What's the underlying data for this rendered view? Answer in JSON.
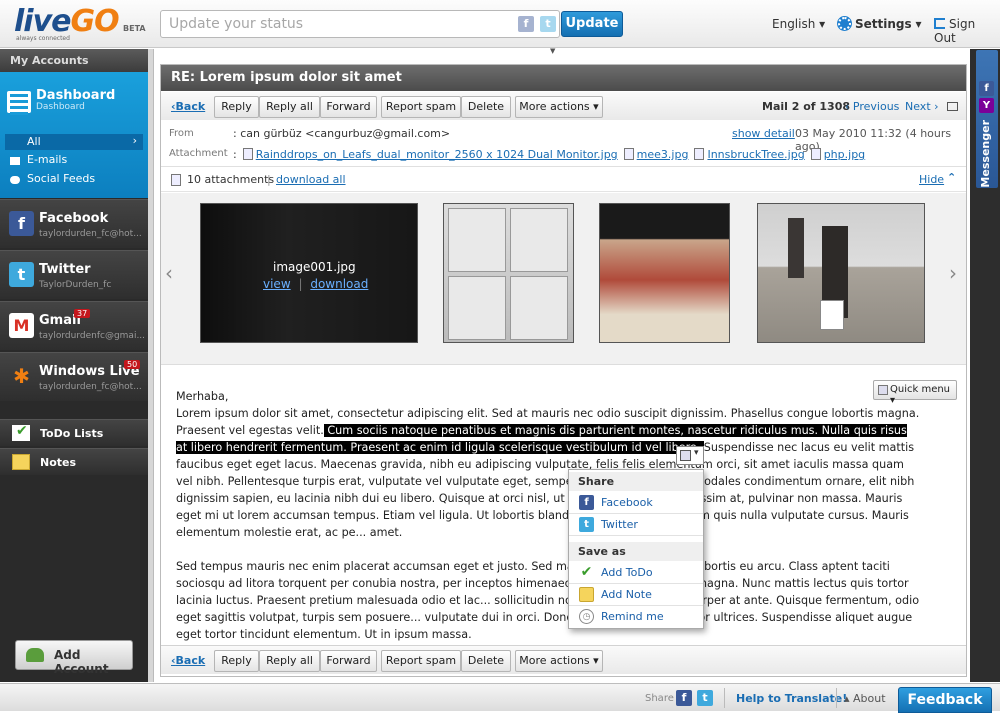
{
  "app": {
    "logo_live": "live",
    "logo_go": "GO",
    "logo_beta": "BETA",
    "logo_tagline": "always connected"
  },
  "header": {
    "status_placeholder": "Update your status",
    "update_label": "Update",
    "language": "English",
    "settings": "Settings",
    "signout": "Sign Out"
  },
  "sidebar": {
    "heading": "My Accounts",
    "dashboard": {
      "title": "Dashboard",
      "subtitle": "Dashboard"
    },
    "filters": [
      "All",
      "E-mails",
      "Social Feeds"
    ],
    "accounts": [
      {
        "name": "Facebook",
        "user": "taylordurden_fc@hot...",
        "badge": "",
        "icon": "facebook-icon",
        "color": "#3b5998"
      },
      {
        "name": "Twitter",
        "user": "TaylorDurden_fc",
        "badge": "",
        "icon": "twitter-icon",
        "color": "#3ea9dd"
      },
      {
        "name": "Gmail",
        "user": "taylordurdenfc@gmai...",
        "badge": "37",
        "icon": "gmail-icon",
        "color": "#d93025"
      },
      {
        "name": "Windows Live",
        "user": "taylordurden_fc@hot...",
        "badge": "50",
        "icon": "windows-live-icon",
        "color": "#f07f12"
      }
    ],
    "tools": [
      "ToDo Lists",
      "Notes"
    ],
    "add_account": "Add Account"
  },
  "mail": {
    "subject": "RE: Lorem ipsum dolor sit amet",
    "toolbar": {
      "back": "Back",
      "reply": "Reply",
      "reply_all": "Reply all",
      "forward": "Forward",
      "report_spam": "Report spam",
      "delete": "Delete",
      "more_actions": "More actions"
    },
    "position": "Mail 2 of 1308",
    "previous": "Previous",
    "next": "Next",
    "from_label": "From",
    "from_value": ": can gürbüz <cangurbuz@gmail.com>",
    "show_detail": "show detail",
    "date": "03 May 2010 11:32 (4 hours ago)",
    "attachment_label": "Attachment",
    "attachments": [
      "Rainddrops_on_Leafs_dual_monitor_2560 x 1024 Dual Monitor.jpg",
      "mee3.jpg",
      "InnsbruckTree.jpg",
      "php.jpg"
    ],
    "attachments_count": "10 attachments",
    "download_all": "download all",
    "hide": "Hide",
    "gallery": {
      "first_name": "image001.jpg",
      "view": "view",
      "download": "download"
    },
    "quick_menu": "Quick menu",
    "body": {
      "greeting": "Merhaba,",
      "p1_a": "Lorem ipsum dolor sit amet, consectetur adipiscing elit. Sed at mauris nec odio suscipit dignissim. Phasellus congue lobortis magna. Praesent vel egestas velit.",
      "p1_sel": " Cum sociis natoque penatibus et magnis dis parturient montes, nascetur ridiculus mus. Nulla quis risus at libero hendrerit fermentum. Praesent ac enim id ligula scelerisque vestibulum id vel libero. ",
      "p1_b": "Suspendisse nec lacus eu velit mattis faucibus eget eget lacus. Maecenas gravida, nibh eu adipiscing vulputate, felis felis elementum orci, sit amet iaculis massa quam vel nibh. Pellentesque turpis erat, vulputate vel vulputate eget, semper sed nulla. Maecenas sodales condimentum ornare, elit nibh dignissim sapien, eu lacinia nibh dui eu libero. Quisque at orci nisl, ut pellentesque eget dignissim at, pulvinar non massa. Mauris eget mi ut lorem accumsan tempus. Etiam vel ligula. Ut lobortis blandit tortor. Integer vel enim quis nulla vulputate cursus. Mauris elementum molestie erat, ac pe... amet.",
      "p2": "Sed tempus mauris nec enim placerat accumsan eget et justo. Sed mauris... venenatis nec, lobortis eu arcu. Class aptent taciti sociosqu ad litora torquent per conubia nostra, per inceptos himenaeos... luctus, id tristique magna. Nunc mattis lectus quis tortor lacinia luctus. Praesent pretium malesuada odio et lac... sollicitudin non posuere nec, ullamcorper at ante. Quisque fermentum, odio eget sagittis volutpat, turpis sem posuere... vulputate dui in orci. Donec eu odio a justo tempor ultrices. Suspendisse aliquet augue eget tortor tincidunt elementum. Ut in ipsum massa."
    },
    "popup": {
      "share_heading": "Share",
      "share_items": [
        "Facebook",
        "Twitter"
      ],
      "save_heading": "Save as",
      "save_items": [
        "Add ToDo",
        "Add Note",
        "Remind me"
      ]
    }
  },
  "messenger": {
    "label": "Messenger"
  },
  "footer": {
    "share": "Share",
    "translate": "Help to Translate!",
    "about": "About",
    "feedback": "Feedback"
  }
}
